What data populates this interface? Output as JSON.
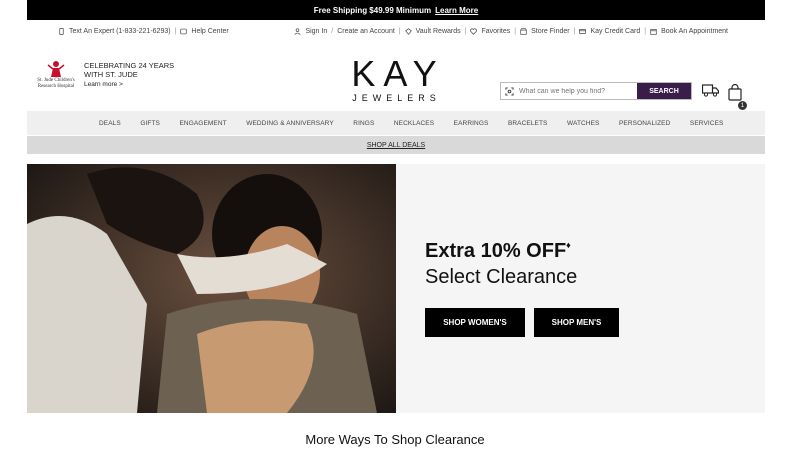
{
  "promo": {
    "text": "Free Shipping $49.99 Minimum",
    "link": "Learn More"
  },
  "utility_left": {
    "expert": "Text An Expert (1-833-221-6293)",
    "help": "Help Center"
  },
  "utility_right": {
    "sign_in": "Sign In",
    "create_account": "Create an Account",
    "vault": "Vault Rewards",
    "favorites": "Favorites",
    "store_finder": "Store Finder",
    "credit_card": "Kay Credit Card",
    "appointment": "Book An Appointment"
  },
  "stjude": {
    "logo_text": "St. Jude Children's Research Hospital",
    "line1": "CELEBRATING 24 YEARS",
    "line2": "WITH ST. JUDE",
    "learn": "Learn more >"
  },
  "brand": {
    "name": "KAY",
    "sub": "JEWELERS"
  },
  "search": {
    "placeholder": "What can we help you find?",
    "button": "SEARCH"
  },
  "cart": {
    "count": "1"
  },
  "nav": [
    "DEALS",
    "GIFTS",
    "ENGAGEMENT",
    "WEDDING & ANNIVERSARY",
    "RINGS",
    "NECKLACES",
    "EARRINGS",
    "BRACELETS",
    "WATCHES",
    "PERSONALIZED",
    "SERVICES"
  ],
  "shop_all": "SHOP ALL DEALS",
  "hero": {
    "headline": "Extra 10% OFF",
    "headline_mark": "♦",
    "sub": "Select Clearance",
    "btn_women": "SHOP WOMEN'S",
    "btn_men": "SHOP MEN'S"
  },
  "section_title": "More Ways To Shop Clearance",
  "colors": {
    "accent": "#3b1d4a",
    "promo_bg": "#000000",
    "nav_bg": "#efefef"
  },
  "icons": [
    "phone-icon",
    "help-icon",
    "user-icon",
    "vault-icon",
    "heart-icon",
    "store-icon",
    "card-icon",
    "calendar-icon",
    "scan-icon",
    "truck-icon",
    "bag-icon"
  ]
}
